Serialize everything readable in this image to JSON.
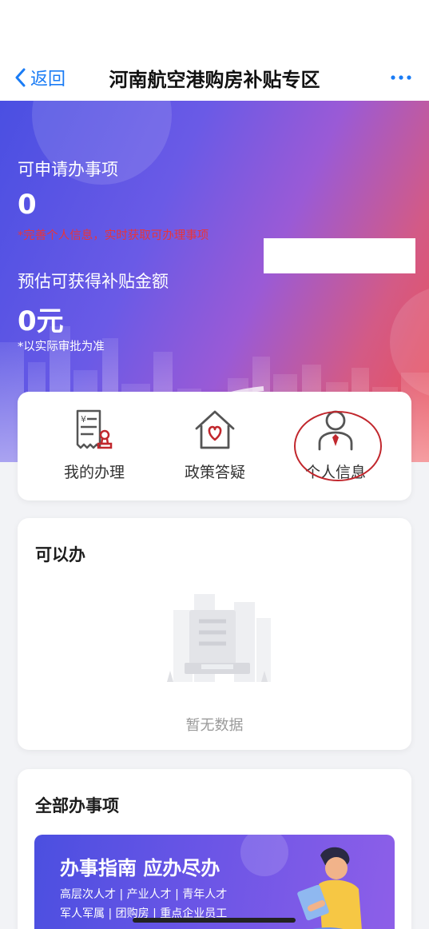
{
  "nav": {
    "back_label": "返回",
    "title": "河南航空港购房补贴专区"
  },
  "hero": {
    "applicable_label": "可申请办事项",
    "applicable_value": "0",
    "warning": "*完善个人信息，实时获取可办理事项",
    "subsidy_label": "预估可获得补贴金额",
    "subsidy_value": "0元",
    "note": "*以实际审批为准"
  },
  "entries": [
    {
      "label": "我的办理",
      "icon": "receipt-stamp-icon"
    },
    {
      "label": "政策答疑",
      "icon": "house-heart-icon"
    },
    {
      "label": "个人信息",
      "icon": "person-tie-icon"
    }
  ],
  "todo": {
    "title": "可以办",
    "empty_text": "暂无数据"
  },
  "all": {
    "title": "全部办事项",
    "banner_title": "办事指南 应办尽办",
    "banner_line1": "高层次人才 | 产业人才 | 青年人才",
    "banner_line2": "军人军属 | 团购房 | 重点企业员工"
  },
  "colors": {
    "accent": "#1a7cf5",
    "warning": "#e8343a",
    "highlight_ring": "#c1272d"
  }
}
